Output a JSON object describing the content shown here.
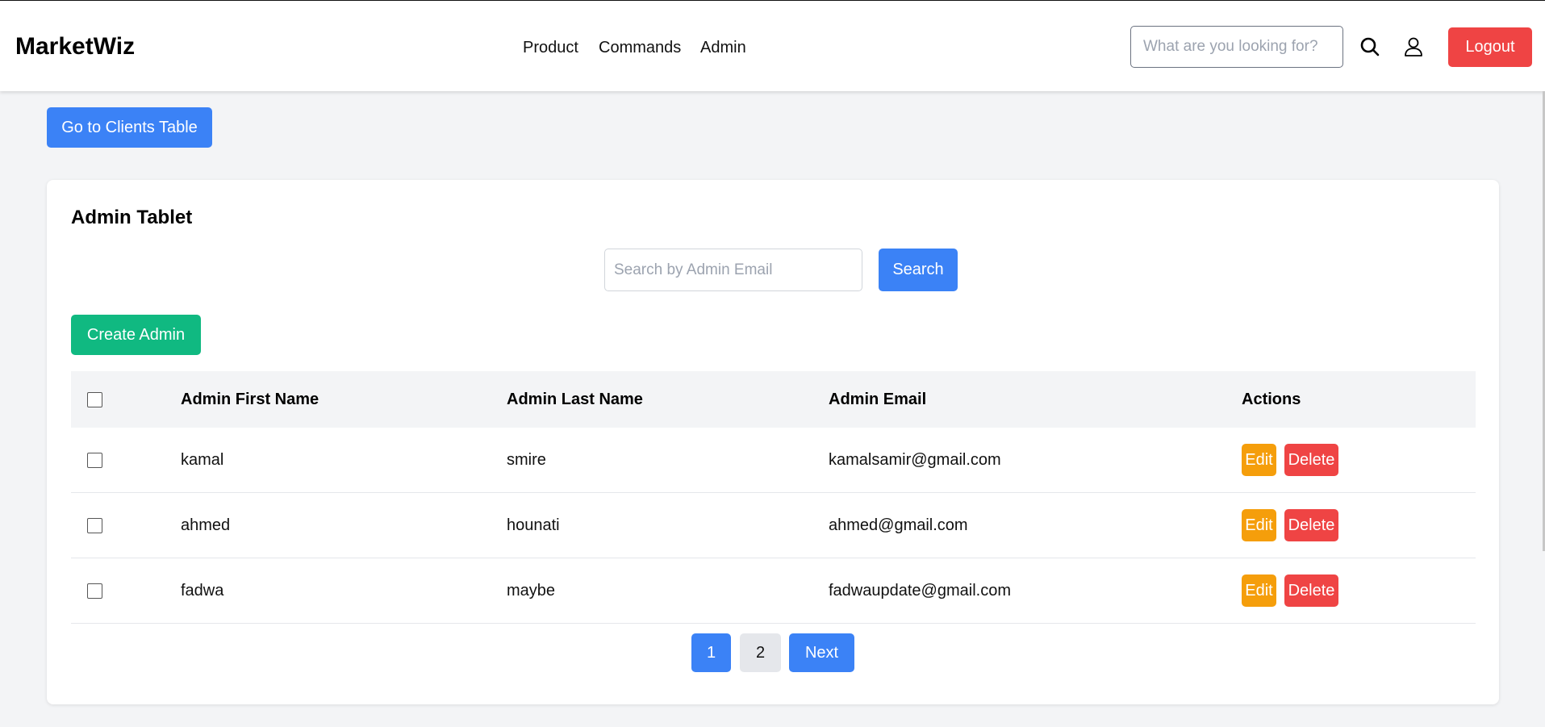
{
  "header": {
    "brand": "MarketWiz",
    "nav": [
      {
        "label": "Product"
      },
      {
        "label": "Commands"
      },
      {
        "label": "Admin"
      }
    ],
    "search_placeholder": "What are you looking for?",
    "search_icon": "search-icon",
    "user_icon": "user-icon",
    "logout_label": "Logout"
  },
  "go_to_clients_label": "Go to Clients Table",
  "card": {
    "title": "Admin Tablet",
    "search_placeholder": "Search by Admin Email",
    "search_label": "Search",
    "create_label": "Create Admin",
    "columns": {
      "first_name": "Admin First Name",
      "last_name": "Admin Last Name",
      "email": "Admin Email",
      "actions": "Actions"
    },
    "rows": [
      {
        "first_name": "kamal",
        "last_name": "smire",
        "email": "kamalsamir@gmail.com",
        "edit": "Edit",
        "delete": "Delete"
      },
      {
        "first_name": "ahmed",
        "last_name": "hounati",
        "email": "ahmed@gmail.com",
        "edit": "Edit",
        "delete": "Delete"
      },
      {
        "first_name": "fadwa",
        "last_name": "maybe",
        "email": "fadwaupdate@gmail.com",
        "edit": "Edit",
        "delete": "Delete"
      }
    ]
  },
  "pagination": {
    "pages": [
      "1",
      "2"
    ],
    "current_page": "1",
    "next_label": "Next"
  },
  "colors": {
    "primary": "#3b82f6",
    "success": "#10b981",
    "warning": "#f59e0b",
    "danger": "#ef4444"
  }
}
